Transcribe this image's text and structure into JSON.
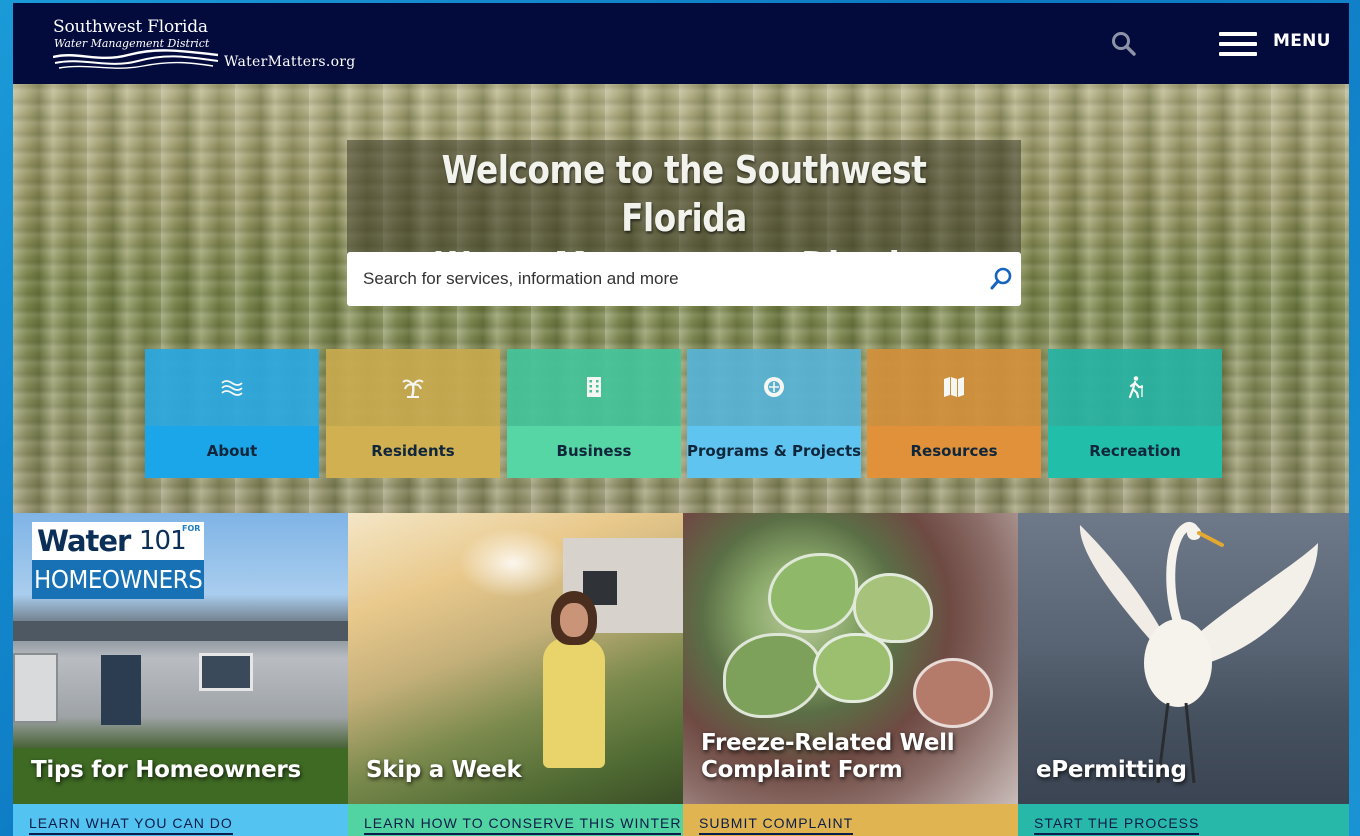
{
  "header": {
    "logo_line1": "Southwest Florida",
    "logo_line2": "Water Management District",
    "logo_url": "WaterMatters.org",
    "menu_label": "MENU"
  },
  "hero": {
    "title": "Welcome to the Southwest Florida\nWater Management District",
    "search_placeholder": "Search for services, information and more"
  },
  "tiles": [
    {
      "label": "About",
      "icon": "waves-icon",
      "top_color": "#2ba8e0",
      "bottom_color": "#1ba6ea"
    },
    {
      "label": "Residents",
      "icon": "palm-tree-icon",
      "top_color": "#c8aa4f",
      "bottom_color": "#d1b052"
    },
    {
      "label": "Business",
      "icon": "building-icon",
      "top_color": "#45c49a",
      "bottom_color": "#55d6a4"
    },
    {
      "label": "Programs & Projects",
      "icon": "globe-gear-icon",
      "top_color": "#58b4d6",
      "bottom_color": "#60c4f0"
    },
    {
      "label": "Resources",
      "icon": "map-icon",
      "top_color": "#d2903c",
      "bottom_color": "#e0913a"
    },
    {
      "label": "Recreation",
      "icon": "hiker-icon",
      "top_color": "#28b3a3",
      "bottom_color": "#21bfa9"
    }
  ],
  "cards": [
    {
      "title": "Tips for Homeowners",
      "link": "LEARN WHAT YOU CAN DO",
      "band_color": "#53c3f1",
      "badge": {
        "water": "Water",
        "number": "101",
        "for": "FOR",
        "homeowners": "HOMEOWNERS"
      }
    },
    {
      "title": "Skip a Week",
      "link": "LEARN HOW TO CONSERVE THIS WINTER",
      "band_color": "#52d3a2"
    },
    {
      "title": "Freeze-Related Well\nComplaint Form",
      "link": "SUBMIT COMPLAINT",
      "band_color": "#e0b451"
    },
    {
      "title": "ePermitting",
      "link": "START THE PROCESS",
      "band_color": "#27b8a9"
    }
  ]
}
